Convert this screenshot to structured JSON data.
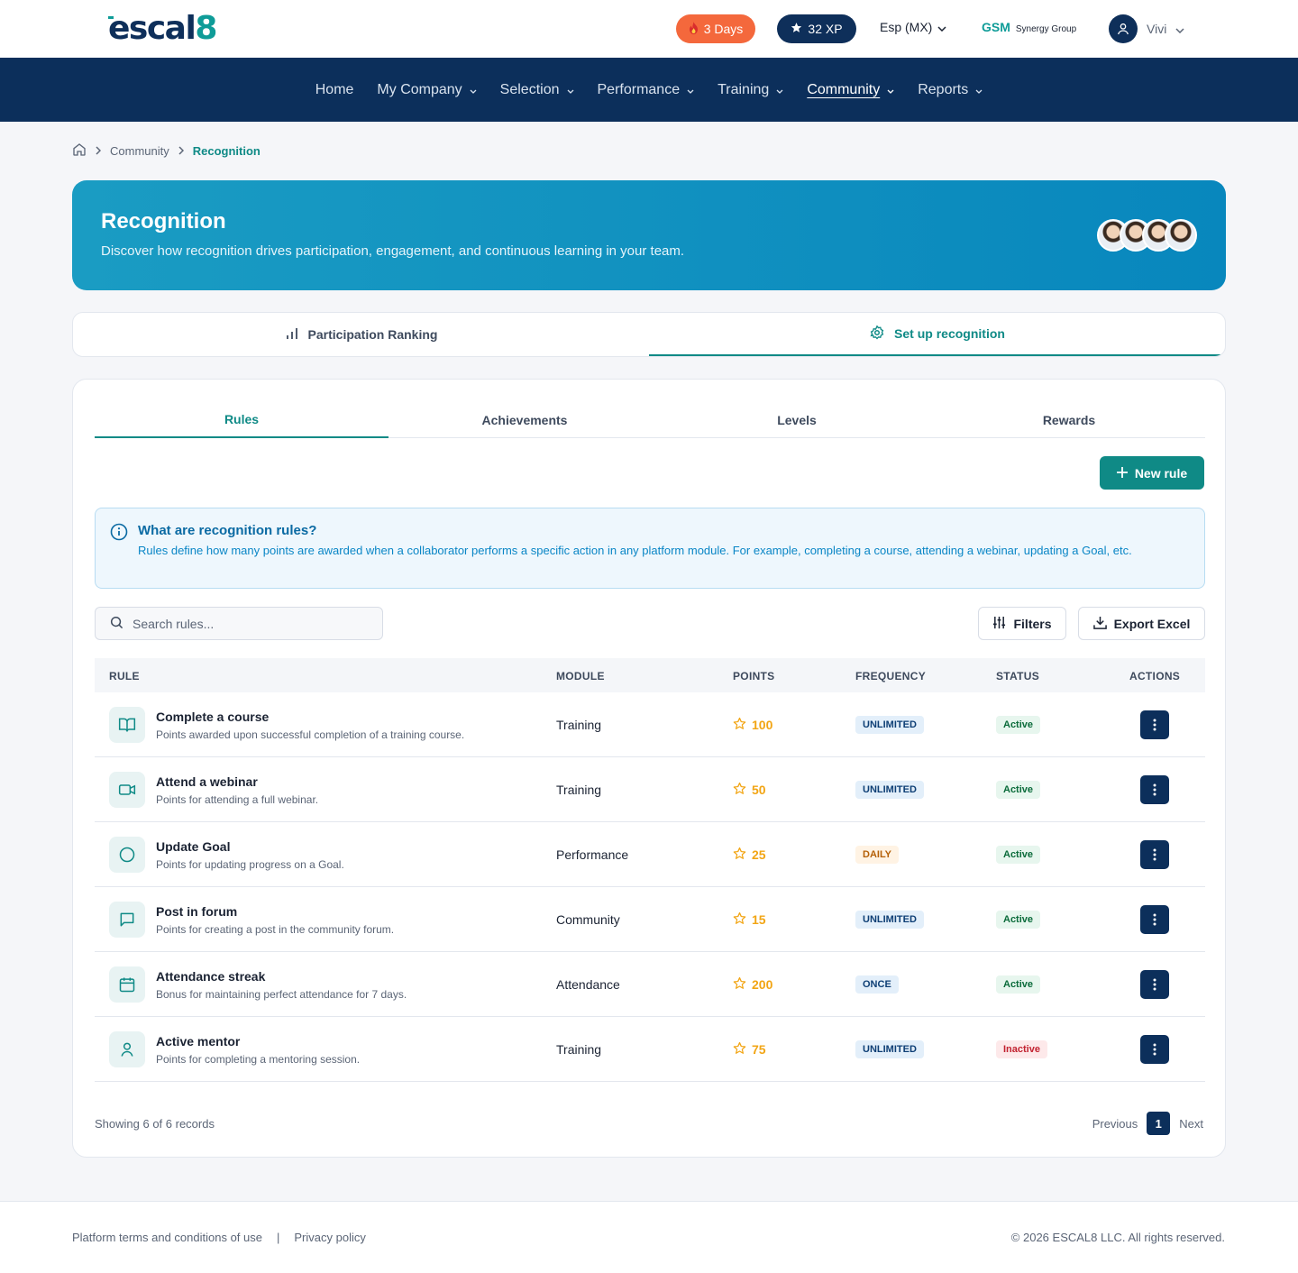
{
  "header": {
    "logo_text": "escal",
    "logo_accent": "8",
    "streak": "3 Days",
    "xp": "32 XP",
    "language": "Esp (MX)",
    "company_code": "GSM",
    "company_name": "Synergy Group",
    "user_name": "Vivi"
  },
  "nav": {
    "items": [
      {
        "label": "Home"
      },
      {
        "label": "My Company"
      },
      {
        "label": "Selection"
      },
      {
        "label": "Performance"
      },
      {
        "label": "Training"
      },
      {
        "label": "Community"
      },
      {
        "label": "Reports"
      }
    ],
    "active": "Community"
  },
  "breadcrumb": {
    "items": [
      "Community",
      "Recognition"
    ]
  },
  "hero": {
    "title": "Recognition",
    "subtitle": "Discover how recognition drives participation, engagement, and continuous learning in your team."
  },
  "main_tabs": [
    {
      "label": "Participation Ranking",
      "icon": "bar-chart-icon"
    },
    {
      "label": "Set up recognition",
      "icon": "gear-icon"
    }
  ],
  "sub_tabs": [
    {
      "label": "Rules"
    },
    {
      "label": "Achievements"
    },
    {
      "label": "Levels"
    },
    {
      "label": "Rewards"
    }
  ],
  "actions": {
    "new_rule": "New rule",
    "filters": "Filters",
    "export": "Export Excel",
    "search_placeholder": "Search rules..."
  },
  "info": {
    "title": "What are recognition rules?",
    "text": "Rules define how many points are awarded when a collaborator performs a specific action in any platform module. For example, completing a course, attending a webinar, updating a Goal, etc."
  },
  "table": {
    "columns": [
      "RULE",
      "MODULE",
      "POINTS",
      "FREQUENCY",
      "STATUS",
      "ACTIONS"
    ],
    "rows": [
      {
        "icon": "book-icon",
        "name": "Complete a course",
        "desc": "Points awarded upon successful completion of a training course.",
        "module": "Training",
        "points": "100",
        "frequency": "UNLIMITED",
        "status": "Active"
      },
      {
        "icon": "video-icon",
        "name": "Attend a webinar",
        "desc": "Points for attending a full webinar.",
        "module": "Training",
        "points": "50",
        "frequency": "UNLIMITED",
        "status": "Active"
      },
      {
        "icon": "target-icon",
        "name": "Update Goal",
        "desc": "Points for updating progress on a Goal.",
        "module": "Performance",
        "points": "25",
        "frequency": "DAILY",
        "status": "Active"
      },
      {
        "icon": "chat-icon",
        "name": "Post in forum",
        "desc": "Points for creating a post in the community forum.",
        "module": "Community",
        "points": "15",
        "frequency": "UNLIMITED",
        "status": "Active"
      },
      {
        "icon": "calendar-icon",
        "name": "Attendance streak",
        "desc": "Bonus for maintaining perfect attendance for 7 days.",
        "module": "Attendance",
        "points": "200",
        "frequency": "ONCE",
        "status": "Active"
      },
      {
        "icon": "user-icon",
        "name": "Active mentor",
        "desc": "Points for completing a mentoring session.",
        "module": "Training",
        "points": "75",
        "frequency": "UNLIMITED",
        "status": "Inactive"
      }
    ]
  },
  "pagination": {
    "summary": "Showing 6 of 6 records",
    "previous": "Previous",
    "page": "1",
    "next": "Next"
  },
  "footer": {
    "terms": "Platform terms and conditions of use",
    "privacy": "Privacy policy",
    "copyright": "© 2026 ESCAL8 LLC. All rights reserved."
  },
  "colors": {
    "navy": "#0c2f5b",
    "teal": "#0f8a86",
    "orange": "#f4683c",
    "gold": "#f2a514"
  }
}
